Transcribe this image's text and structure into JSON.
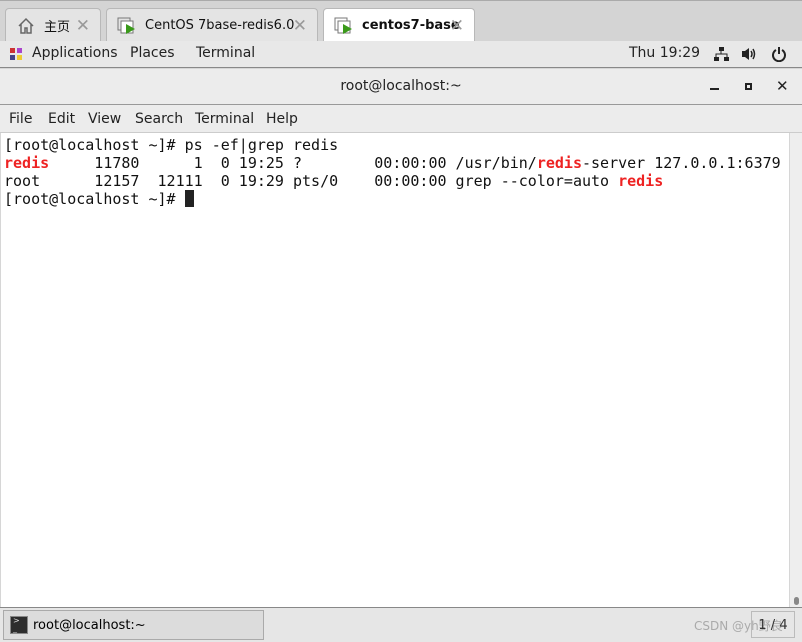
{
  "tabs": [
    {
      "label": "主页",
      "icon": "home-icon"
    },
    {
      "label": "CentOS 7base-redis6.0",
      "icon": "vm-icon"
    },
    {
      "label": "centos7-base",
      "icon": "vm-icon",
      "active": true
    }
  ],
  "topbar": {
    "applications": "Applications",
    "places": "Places",
    "terminal": "Terminal",
    "clock": "Thu 19:29"
  },
  "window": {
    "title": "root@localhost:~"
  },
  "menu": {
    "file": "File",
    "edit": "Edit",
    "view": "View",
    "search": "Search",
    "terminal": "Terminal",
    "help": "Help"
  },
  "terminal": {
    "l1": "[root@localhost ~]# ps -ef|grep redis",
    "l2a": "redis",
    "l2b": "     11780      1  0 19:25 ?        00:00:00 /usr/bin/",
    "l2c": "redis",
    "l2d": "-server 127.0.0.1:6379",
    "l3a": "root      12157  12111  0 19:29 pts/0    00:00:00 grep --color=auto ",
    "l3b": "redis",
    "l4": "[root@localhost ~]# ",
    "highlight_color": "#ee2222"
  },
  "taskbar": {
    "task": "root@localhost:~",
    "workspace": "1 / 4",
    "watermark": "CSDN @yh野良"
  }
}
